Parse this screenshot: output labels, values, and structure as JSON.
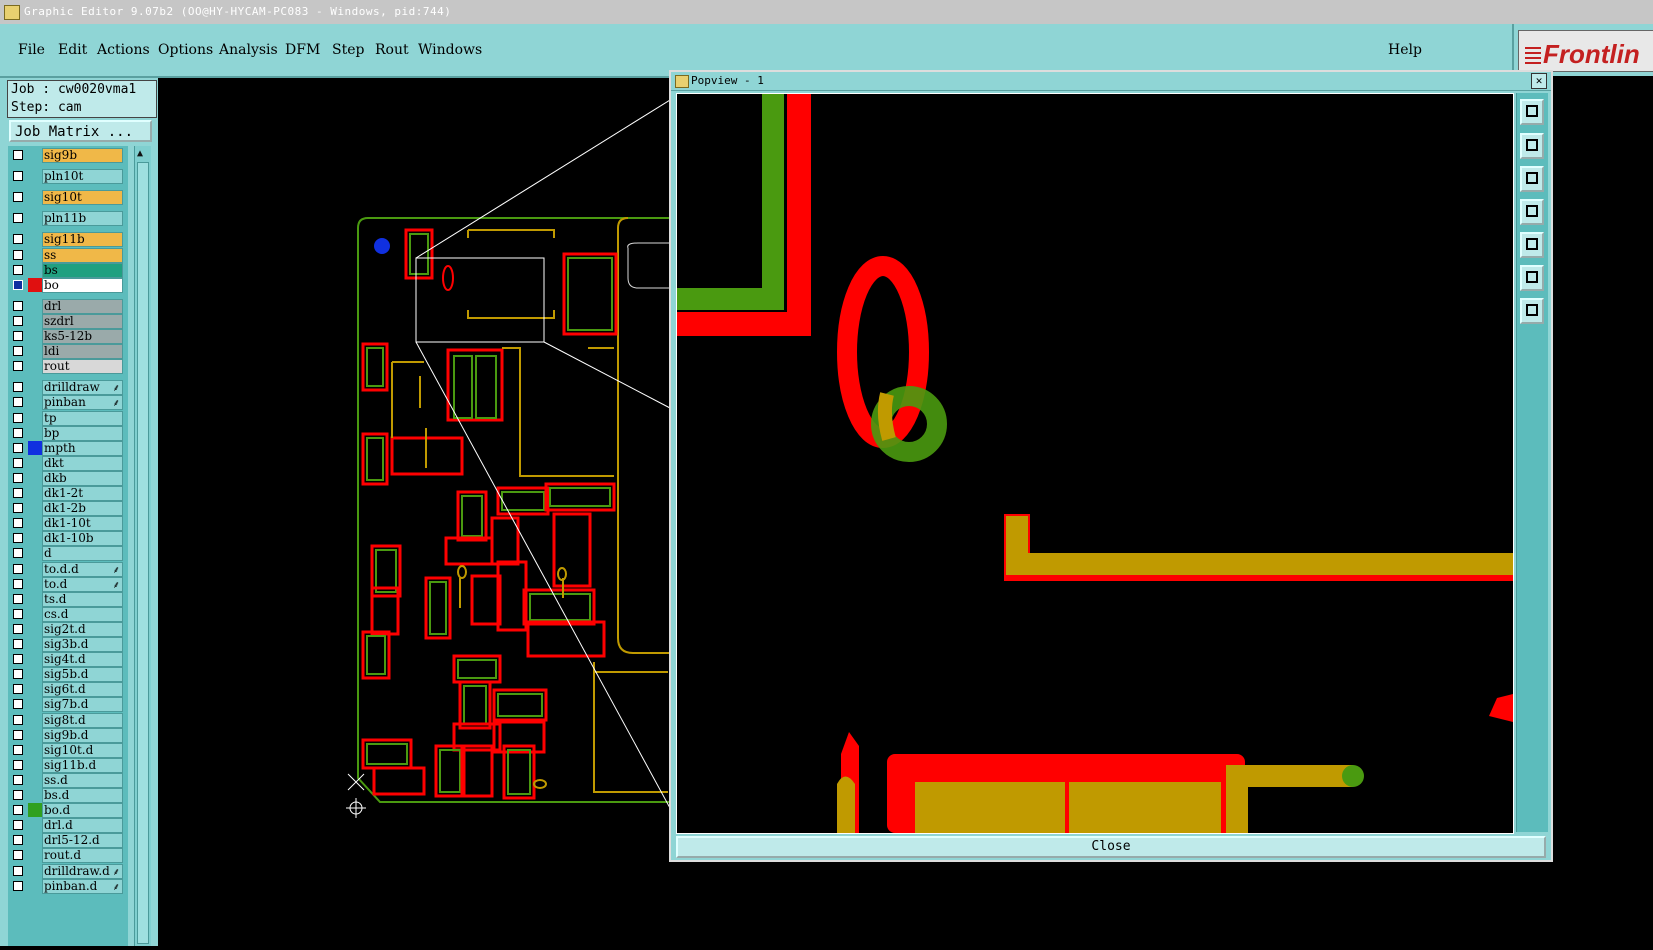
{
  "window": {
    "title": "Graphic Editor 9.07b2 (OO@HY-HYCAM-PC083 - Windows, pid:744)"
  },
  "menu": {
    "items": [
      "File",
      "Edit",
      "Actions",
      "Options",
      "Analysis",
      "DFM",
      "Step",
      "Rout",
      "Windows"
    ],
    "help": "Help"
  },
  "logo": {
    "text_main": "Frontlin"
  },
  "job": {
    "job_line": "Job : cw0020vma1",
    "step_line": "Step: cam",
    "matrix_button": "Job Matrix ..."
  },
  "layers": [
    {
      "name": "sig9b",
      "color": "#f0b848",
      "swatch": ""
    },
    {
      "name": "pln10t",
      "color": "#8fd5d5",
      "swatch": ""
    },
    {
      "name": "sig10t",
      "color": "#f0b848",
      "swatch": ""
    },
    {
      "name": "pln11b",
      "color": "#8fd5d5",
      "swatch": ""
    },
    {
      "name": "sig11b",
      "color": "#f0b848",
      "swatch": ""
    },
    {
      "name": "ss",
      "color": "#f0b848",
      "swatch": ""
    },
    {
      "name": "bs",
      "color": "#20a080",
      "swatch": ""
    },
    {
      "name": "bo",
      "color": "#ffffff",
      "swatch": "#e01010",
      "active": true
    },
    {
      "name": "drl",
      "color": "#9aaaaa",
      "swatch": ""
    },
    {
      "name": "szdrl",
      "color": "#9aaaaa",
      "swatch": ""
    },
    {
      "name": "ks5-12b",
      "color": "#9aaaaa",
      "swatch": ""
    },
    {
      "name": "ldi",
      "color": "#9aaaaa",
      "swatch": ""
    },
    {
      "name": "rout",
      "color": "#d8d8d8",
      "swatch": ""
    },
    {
      "name": "drilldraw",
      "color": "#8fd5d5",
      "swatch": "",
      "mark": "⸙"
    },
    {
      "name": "pinban",
      "color": "#8fd5d5",
      "swatch": "",
      "mark": "⸙"
    },
    {
      "name": "tp",
      "color": "#8fd5d5",
      "swatch": ""
    },
    {
      "name": "bp",
      "color": "#8fd5d5",
      "swatch": ""
    },
    {
      "name": "mpth",
      "color": "#8fd5d5",
      "swatch": "#1030e0"
    },
    {
      "name": "dkt",
      "color": "#8fd5d5",
      "swatch": ""
    },
    {
      "name": "dkb",
      "color": "#8fd5d5",
      "swatch": ""
    },
    {
      "name": "dk1-2t",
      "color": "#8fd5d5",
      "swatch": ""
    },
    {
      "name": "dk1-2b",
      "color": "#8fd5d5",
      "swatch": ""
    },
    {
      "name": "dk1-10t",
      "color": "#8fd5d5",
      "swatch": ""
    },
    {
      "name": "dk1-10b",
      "color": "#8fd5d5",
      "swatch": ""
    },
    {
      "name": "d",
      "color": "#8fd5d5",
      "swatch": ""
    },
    {
      "name": "to.d.d",
      "color": "#8fd5d5",
      "swatch": "",
      "mark": "⸙"
    },
    {
      "name": "to.d",
      "color": "#8fd5d5",
      "swatch": "",
      "mark": "⸙"
    },
    {
      "name": "ts.d",
      "color": "#8fd5d5",
      "swatch": ""
    },
    {
      "name": "cs.d",
      "color": "#8fd5d5",
      "swatch": ""
    },
    {
      "name": "sig2t.d",
      "color": "#8fd5d5",
      "swatch": ""
    },
    {
      "name": "sig3b.d",
      "color": "#8fd5d5",
      "swatch": ""
    },
    {
      "name": "sig4t.d",
      "color": "#8fd5d5",
      "swatch": ""
    },
    {
      "name": "sig5b.d",
      "color": "#8fd5d5",
      "swatch": ""
    },
    {
      "name": "sig6t.d",
      "color": "#8fd5d5",
      "swatch": ""
    },
    {
      "name": "sig7b.d",
      "color": "#8fd5d5",
      "swatch": ""
    },
    {
      "name": "sig8t.d",
      "color": "#8fd5d5",
      "swatch": ""
    },
    {
      "name": "sig9b.d",
      "color": "#8fd5d5",
      "swatch": ""
    },
    {
      "name": "sig10t.d",
      "color": "#8fd5d5",
      "swatch": ""
    },
    {
      "name": "sig11b.d",
      "color": "#8fd5d5",
      "swatch": ""
    },
    {
      "name": "ss.d",
      "color": "#8fd5d5",
      "swatch": ""
    },
    {
      "name": "bs.d",
      "color": "#8fd5d5",
      "swatch": ""
    },
    {
      "name": "bo.d",
      "color": "#8fd5d5",
      "swatch": "#30a020"
    },
    {
      "name": "drl.d",
      "color": "#8fd5d5",
      "swatch": ""
    },
    {
      "name": "drl5-12.d",
      "color": "#8fd5d5",
      "swatch": ""
    },
    {
      "name": "rout.d",
      "color": "#8fd5d5",
      "swatch": ""
    },
    {
      "name": "drilldraw.d",
      "color": "#8fd5d5",
      "swatch": "",
      "mark": "⸙"
    },
    {
      "name": "pinban.d",
      "color": "#8fd5d5",
      "swatch": "",
      "mark": "⸙"
    }
  ],
  "popview": {
    "title": "Popview - 1",
    "close_label": "Close",
    "close_x": "✕"
  },
  "colors": {
    "red": "#ff0000",
    "green": "#4a9a10",
    "olive": "#c09a00",
    "panel": "#8fd5d5"
  }
}
